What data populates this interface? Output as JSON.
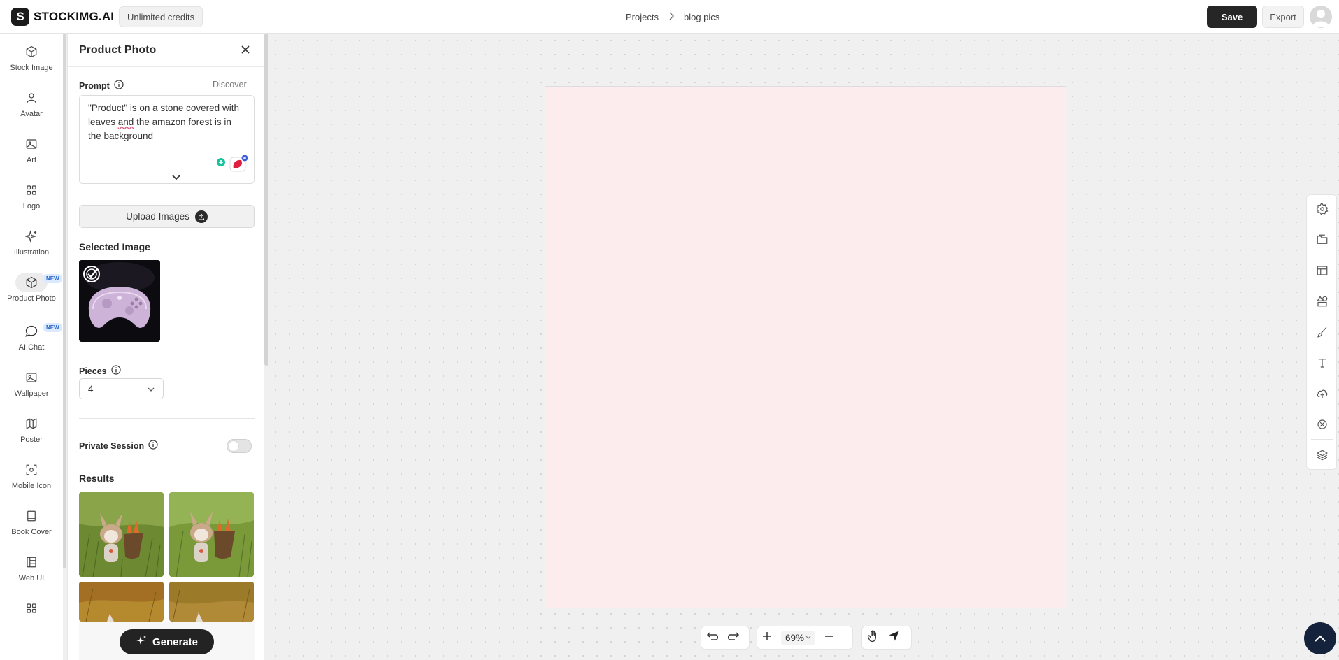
{
  "header": {
    "logo_letter": "S",
    "logo_text": "STOCKIMG.AI",
    "credits": "Unlimited credits",
    "breadcrumb": [
      "Projects",
      "blog pics"
    ],
    "save_label": "Save",
    "export_label": "Export"
  },
  "sidebar": {
    "items": [
      {
        "label": "Stock Image",
        "icon": "cube-icon"
      },
      {
        "label": "Avatar",
        "icon": "user-icon"
      },
      {
        "label": "Art",
        "icon": "image-icon"
      },
      {
        "label": "Logo",
        "icon": "grid-icon"
      },
      {
        "label": "Illustration",
        "icon": "sparkle-icon"
      },
      {
        "label": "Product Photo",
        "icon": "box-icon",
        "badge": "NEW",
        "active": true
      },
      {
        "label": "AI Chat",
        "icon": "chat-bubble-icon",
        "badge": "NEW"
      },
      {
        "label": "Wallpaper",
        "icon": "image-icon"
      },
      {
        "label": "Poster",
        "icon": "map-icon"
      },
      {
        "label": "Mobile Icon",
        "icon": "focus-icon"
      },
      {
        "label": "Book Cover",
        "icon": "book-icon"
      },
      {
        "label": "Web UI",
        "icon": "layout-icon"
      }
    ]
  },
  "panel": {
    "title": "Product Photo",
    "prompt_label": "Prompt",
    "discover_label": "Discover",
    "prompt_parts": [
      "\"Product\" is on a stone covered with leaves ",
      "and",
      " the amazon forest is in the background"
    ],
    "upload_label": "Upload Images",
    "selected_image_label": "Selected Image",
    "pieces_label": "Pieces",
    "pieces_value": "4",
    "private_session_label": "Private Session",
    "private_session_on": false,
    "results_label": "Results",
    "generate_label": "Generate"
  },
  "canvas": {
    "zoom": "69%",
    "artboard_color": "#fdecee"
  },
  "colors": {
    "accent_dark": "#262626",
    "badge_bg": "#dbe9ff",
    "badge_text": "#2563c7"
  }
}
